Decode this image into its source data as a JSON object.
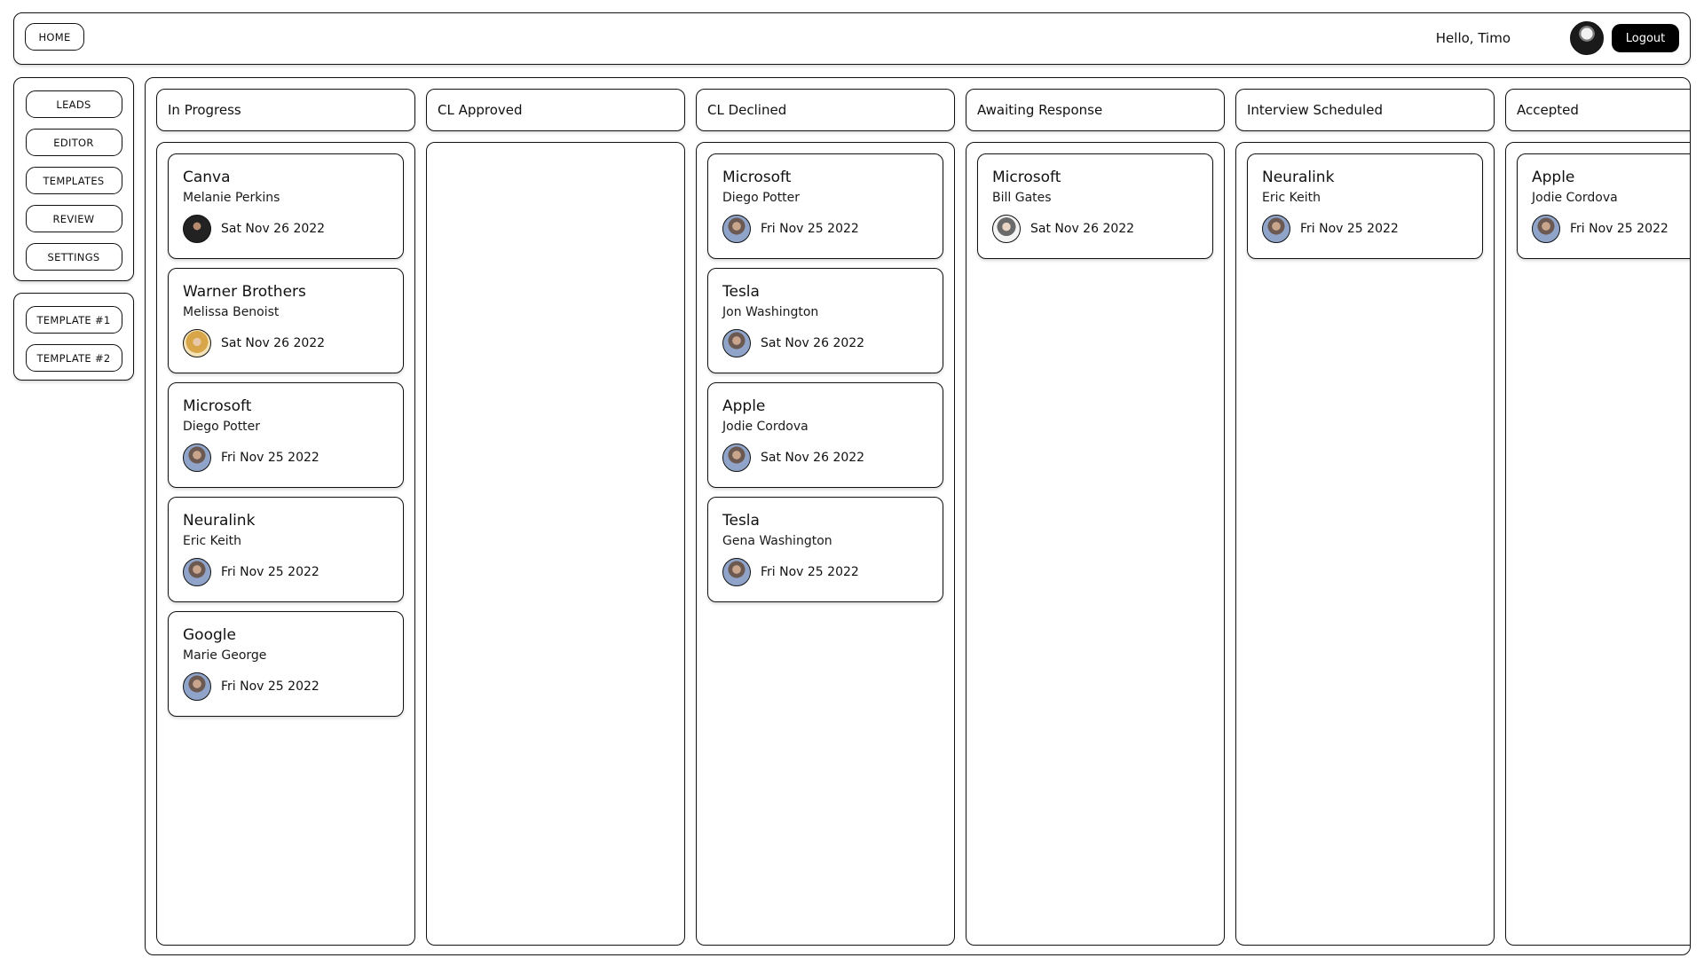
{
  "header": {
    "home_label": "HOME",
    "greeting": "Hello, Timo",
    "logout_label": "Logout"
  },
  "sidebar": {
    "nav": [
      {
        "label": "LEADS"
      },
      {
        "label": "EDITOR"
      },
      {
        "label": "TEMPLATES"
      },
      {
        "label": "REVIEW"
      },
      {
        "label": "SETTINGS"
      }
    ],
    "templates": [
      {
        "label": "TEMPLATE #1"
      },
      {
        "label": "TEMPLATE #2"
      }
    ]
  },
  "columns": [
    {
      "title": "In Progress",
      "cards": [
        {
          "company": "Canva",
          "contact": "Melanie Perkins",
          "date": "Sat Nov 26 2022",
          "avatar": "av-dark"
        },
        {
          "company": "Warner Brothers",
          "contact": "Melissa Benoist",
          "date": "Sat Nov 26 2022",
          "avatar": "av-blonde"
        },
        {
          "company": "Microsoft",
          "contact": "Diego Potter",
          "date": "Fri Nov 25 2022",
          "avatar": "av-default"
        },
        {
          "company": "Neuralink",
          "contact": "Eric Keith",
          "date": "Fri Nov 25 2022",
          "avatar": "av-default"
        },
        {
          "company": "Google",
          "contact": "Marie George",
          "date": "Fri Nov 25 2022",
          "avatar": "av-default"
        }
      ]
    },
    {
      "title": "CL Approved",
      "cards": []
    },
    {
      "title": "CL Declined",
      "cards": [
        {
          "company": "Microsoft",
          "contact": "Diego Potter",
          "date": "Fri Nov 25 2022",
          "avatar": "av-default"
        },
        {
          "company": "Tesla",
          "contact": "Jon Washington",
          "date": "Sat Nov 26 2022",
          "avatar": "av-default"
        },
        {
          "company": "Apple",
          "contact": "Jodie Cordova",
          "date": "Sat Nov 26 2022",
          "avatar": "av-default"
        },
        {
          "company": "Tesla",
          "contact": "Gena Washington",
          "date": "Fri Nov 25 2022",
          "avatar": "av-default"
        }
      ]
    },
    {
      "title": "Awaiting Response",
      "cards": [
        {
          "company": "Microsoft",
          "contact": "Bill Gates",
          "date": "Sat Nov 26 2022",
          "avatar": "av-grey"
        }
      ]
    },
    {
      "title": "Interview Scheduled",
      "cards": [
        {
          "company": "Neuralink",
          "contact": "Eric Keith",
          "date": "Fri Nov 25 2022",
          "avatar": "av-default"
        }
      ]
    },
    {
      "title": "Accepted",
      "cards": [
        {
          "company": "Apple",
          "contact": "Jodie Cordova",
          "date": "Fri Nov 25 2022",
          "avatar": "av-default"
        }
      ]
    }
  ]
}
